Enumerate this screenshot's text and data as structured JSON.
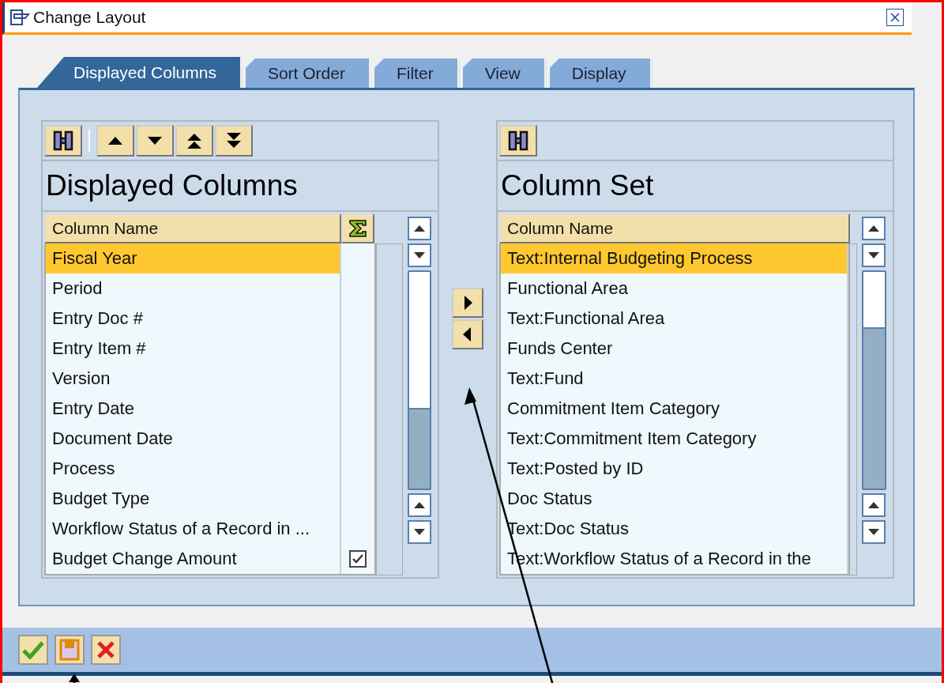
{
  "window": {
    "title": "Change Layout"
  },
  "tabs": [
    {
      "label": "Displayed Columns",
      "selected": true
    },
    {
      "label": "Sort Order",
      "selected": false
    },
    {
      "label": "Filter",
      "selected": false
    },
    {
      "label": "View",
      "selected": false
    },
    {
      "label": "Display",
      "selected": false
    }
  ],
  "displayed_columns": {
    "title": "Displayed Columns",
    "column_header": "Column Name",
    "rows": [
      {
        "name": "Fiscal Year",
        "selected": true,
        "checked": false
      },
      {
        "name": "Period",
        "selected": false,
        "checked": false
      },
      {
        "name": "Entry Doc #",
        "selected": false,
        "checked": false
      },
      {
        "name": "Entry Item #",
        "selected": false,
        "checked": false
      },
      {
        "name": "Version",
        "selected": false,
        "checked": false
      },
      {
        "name": "Entry Date",
        "selected": false,
        "checked": false
      },
      {
        "name": "Document Date",
        "selected": false,
        "checked": false
      },
      {
        "name": "Process",
        "selected": false,
        "checked": false
      },
      {
        "name": "Budget Type",
        "selected": false,
        "checked": false
      },
      {
        "name": "Workflow Status of a Record in ...",
        "selected": false,
        "checked": false
      },
      {
        "name": "Budget Change Amount",
        "selected": false,
        "checked": true
      }
    ]
  },
  "column_set": {
    "title": "Column Set",
    "column_header": "Column Name",
    "rows": [
      {
        "name": "Text:Internal Budgeting Process",
        "selected": true
      },
      {
        "name": "Functional Area",
        "selected": false
      },
      {
        "name": "Text:Functional Area",
        "selected": false
      },
      {
        "name": "Funds Center",
        "selected": false
      },
      {
        "name": "Text:Fund",
        "selected": false
      },
      {
        "name": "Commitment Item Category",
        "selected": false
      },
      {
        "name": "Text:Commitment Item Category",
        "selected": false
      },
      {
        "name": "Text:Posted by ID",
        "selected": false
      },
      {
        "name": "Doc Status",
        "selected": false
      },
      {
        "name": "Text:Doc Status",
        "selected": false
      },
      {
        "name": "Text:Workflow Status of a Record in the",
        "selected": false
      }
    ]
  }
}
